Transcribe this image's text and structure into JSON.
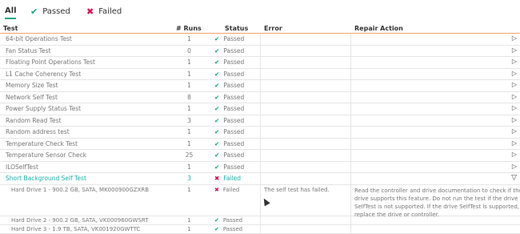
{
  "filters": {
    "all": "All",
    "passed": "Passed",
    "failed": "Failed"
  },
  "table": {
    "headers": {
      "test": "Test",
      "runs": "# Runs",
      "status": "Status",
      "error": "Error",
      "repair": "Repair Action"
    },
    "rows": [
      {
        "test": "64-bit Operations Test",
        "runs": "1",
        "status": "Passed"
      },
      {
        "test": "Fan Status Test",
        "runs": "0",
        "status": "Passed"
      },
      {
        "test": "Floating Point Operations Test",
        "runs": "1",
        "status": "Passed"
      },
      {
        "test": "L1 Cache Coherency Test",
        "runs": "1",
        "status": "Passed"
      },
      {
        "test": "Memory Size Test",
        "runs": "1",
        "status": "Passed"
      },
      {
        "test": "Network Self Test",
        "runs": "8",
        "status": "Passed"
      },
      {
        "test": "Power Supply Status Test",
        "runs": "1",
        "status": "Passed"
      },
      {
        "test": "Random Read Test",
        "runs": "3",
        "status": "Passed"
      },
      {
        "test": "Random address test",
        "runs": "1",
        "status": "Passed"
      },
      {
        "test": "Temperature Check Test",
        "runs": "1",
        "status": "Passed"
      },
      {
        "test": "Temperature Sensor Check",
        "runs": "25",
        "status": "Passed"
      },
      {
        "test": "ILOSelfTest",
        "runs": "1",
        "status": "Passed"
      }
    ],
    "selected": {
      "test": "Short Background Self Test",
      "runs": "3",
      "status": "Failed"
    },
    "detail": {
      "test": "Hard Drive 1 - 900.2 GB, SATA, MK000900GZXRB",
      "runs": "1",
      "status": "Failed",
      "error": "The self test has failed.",
      "repair": "Read the controller and drive documentation to check if the drive supports this feature. Do not run the test if the drive SelfTest is not supported. If the drive SelfTest is supported, replace the drive or controller."
    },
    "subrows": [
      {
        "test": "Hard Drive 2 - 900.2 GB, SATA, VK000960GWSRT",
        "runs": "1",
        "status": "Passed"
      },
      {
        "test": "Hard Drive 3 - 1.9 TB, SATA, VK001920GWTTC",
        "runs": "1",
        "status": "Passed"
      }
    ]
  },
  "icons": {
    "pass": "check-icon",
    "fail": "x-icon",
    "expand": "play-icon",
    "collapse": "chevron-down-icon"
  },
  "colors": {
    "accent": "#01a982",
    "fail": "#e5004c",
    "selected_text": "#1eb0a8",
    "header_border": "#f3a66d"
  }
}
